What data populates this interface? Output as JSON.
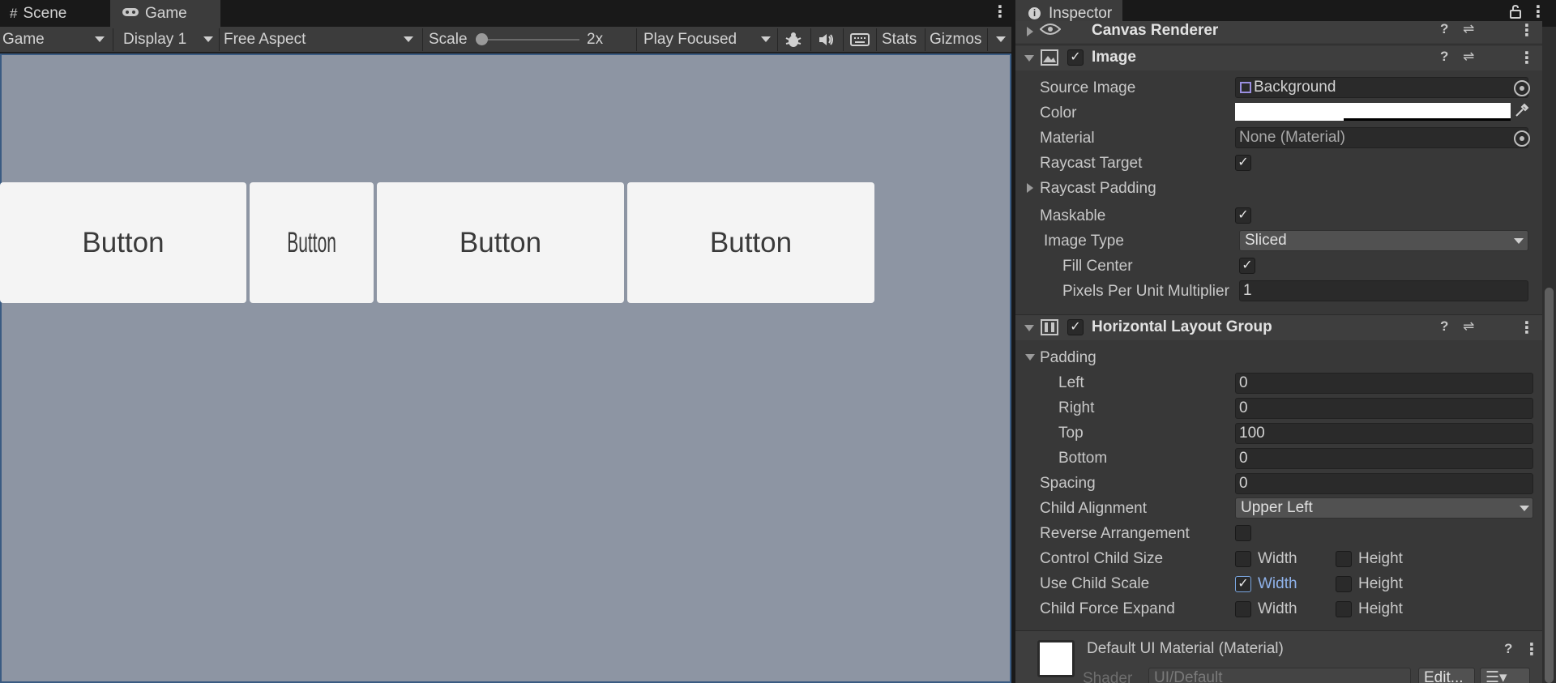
{
  "tabs": {
    "scene_label": "Scene",
    "game_label": "Game",
    "scene_icon": "grid-icon",
    "game_icon": "gamepad-icon"
  },
  "toolbar": {
    "game_dropdown": "Game",
    "display_dropdown": "Display 1",
    "aspect_dropdown": "Free Aspect",
    "scale_label": "Scale",
    "scale_value": "2x",
    "play_mode": "Play Focused",
    "stats_label": "Stats",
    "gizmos_label": "Gizmos"
  },
  "game_view": {
    "background": "#8d95a3",
    "buttons": [
      "Button",
      "Button",
      "Button",
      "Button"
    ]
  },
  "inspector": {
    "tab_label": "Inspector",
    "canvas_renderer": {
      "title": "Canvas Renderer"
    },
    "image": {
      "title": "Image",
      "source_image_label": "Source Image",
      "source_image_value": "Background",
      "color_label": "Color",
      "color_value": "#ffffff",
      "material_label": "Material",
      "material_value": "None (Material)",
      "raycast_target_label": "Raycast Target",
      "raycast_padding_label": "Raycast Padding",
      "maskable_label": "Maskable",
      "image_type_label": "Image Type",
      "image_type_value": "Sliced",
      "fill_center_label": "Fill Center",
      "ppu_label": "Pixels Per Unit Multiplier",
      "ppu_value": "1"
    },
    "hlg": {
      "title": "Horizontal Layout Group",
      "padding_label": "Padding",
      "left_label": "Left",
      "left_value": "0",
      "right_label": "Right",
      "right_value": "0",
      "top_label": "Top",
      "top_value": "100",
      "bottom_label": "Bottom",
      "bottom_value": "0",
      "spacing_label": "Spacing",
      "spacing_value": "0",
      "child_alignment_label": "Child Alignment",
      "child_alignment_value": "Upper Left",
      "reverse_label": "Reverse Arrangement",
      "control_child_size_label": "Control Child Size",
      "use_child_scale_label": "Use Child Scale",
      "child_force_expand_label": "Child Force Expand",
      "width_label": "Width",
      "height_label": "Height"
    },
    "material": {
      "title": "Default UI Material (Material)",
      "shader_label": "Shader",
      "shader_value": "UI/Default",
      "edit_label": "Edit..."
    }
  }
}
